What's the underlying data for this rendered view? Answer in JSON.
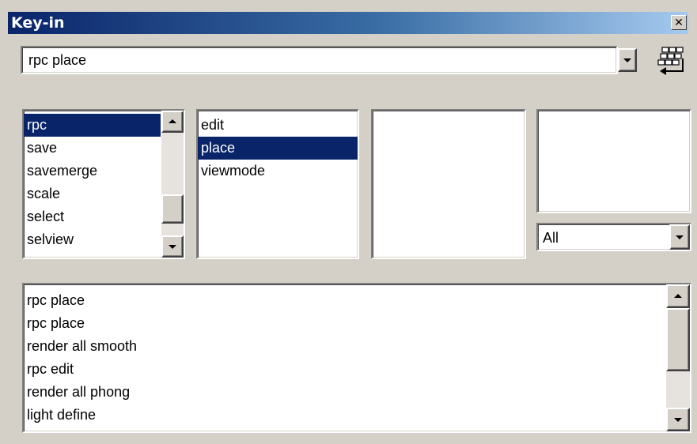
{
  "window": {
    "title": "Key-in",
    "close_label": "✕"
  },
  "keyin": {
    "value": "rpc place"
  },
  "list1": {
    "items": [
      {
        "label": "rpc",
        "selected": true
      },
      {
        "label": "save"
      },
      {
        "label": "savemerge"
      },
      {
        "label": "scale"
      },
      {
        "label": "select"
      },
      {
        "label": "selview"
      }
    ]
  },
  "list2": {
    "items": [
      {
        "label": "edit"
      },
      {
        "label": "place",
        "selected": true
      },
      {
        "label": "viewmode"
      }
    ]
  },
  "filter": {
    "value": "All"
  },
  "history": {
    "items": [
      "rpc place",
      "rpc place",
      "render all smooth",
      "rpc edit",
      "render all phong",
      "light define"
    ]
  },
  "icons": {
    "close": "close-icon",
    "dropdown": "chevron-down-icon",
    "keypad": "keypad-icon"
  },
  "colors": {
    "selection": "#0a246a",
    "face": "#d4d0c8"
  }
}
